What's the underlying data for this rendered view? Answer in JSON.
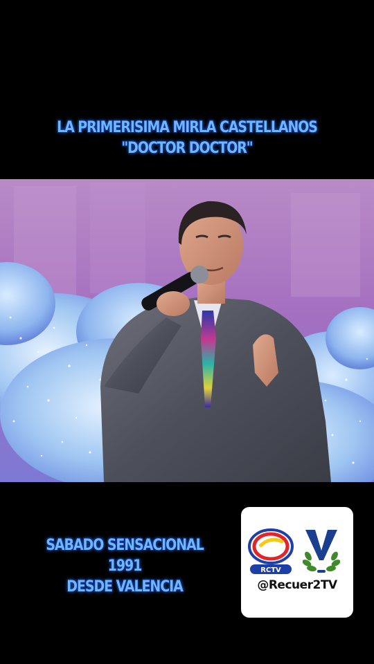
{
  "overlay": {
    "top_title_line1": "LA PRIMERISIMA MIRLA CASTELLANOS",
    "top_title_line2": "\"DOCTOR DOCTOR\"",
    "bottom_line1": "SABADO SENSACIONAL",
    "bottom_line2": "1991",
    "bottom_line3": "DESDE VALENCIA"
  },
  "logo_card": {
    "rctv_label": "RCTV",
    "handle": "@Recuer2TV"
  },
  "colors": {
    "caption_text": "#6fb6ff",
    "caption_outline": "#0a2f8a",
    "background": "#000000",
    "stage_purple": "#b17ac2",
    "card_bg": "#ffffff",
    "rctv_blue": "#1e3fa8",
    "rctv_red": "#e0262b",
    "rctv_yellow": "#f6c916",
    "v_blue": "#1b3f8f",
    "laurel_green": "#3f8a2a"
  }
}
